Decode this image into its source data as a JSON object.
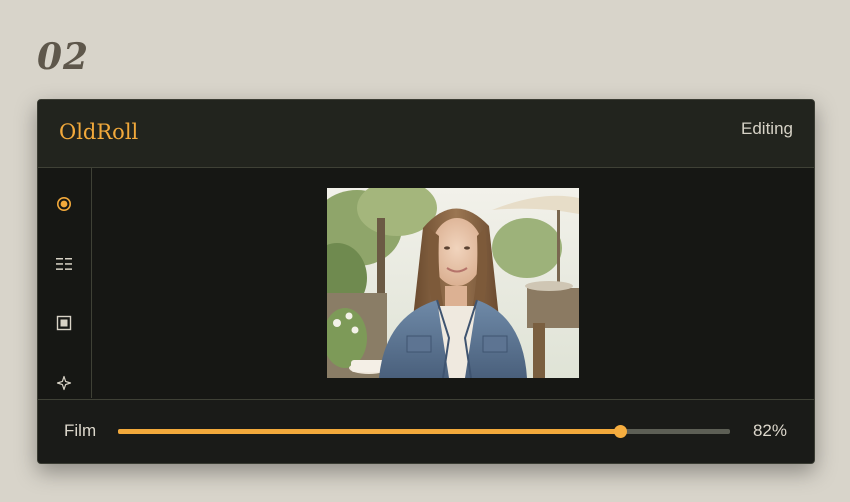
{
  "page_number": "02",
  "app": {
    "brand": "OldRoll",
    "status": "Editing"
  },
  "sidebar": {
    "items": [
      {
        "icon": "radio-target-icon",
        "active": true
      },
      {
        "icon": "list-icon",
        "active": false
      },
      {
        "icon": "frame-icon",
        "active": false
      },
      {
        "icon": "sparkle-icon",
        "active": false
      }
    ]
  },
  "canvas": {
    "image": "woman-in-denim-jacket-at-outdoor-cafe"
  },
  "footer": {
    "slider_label": "Film",
    "slider_value": 82,
    "slider_value_text": "82%"
  },
  "colors": {
    "accent": "#f2a93b",
    "background": "#d8d4ca",
    "panel": "#161714",
    "header": "#22241e"
  }
}
